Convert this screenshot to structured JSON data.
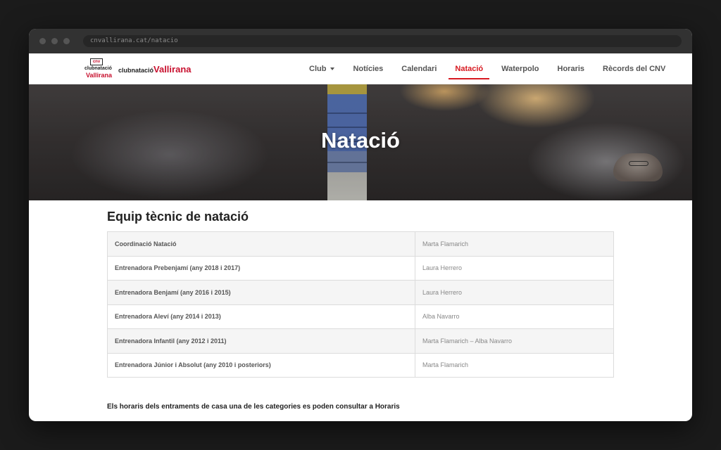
{
  "browser": {
    "url": "cnvallirana.cat/natacio"
  },
  "logo": {
    "mark_top": "cnv",
    "mark_line1": "clubnatació",
    "mark_line2": "Vallirana",
    "text_prefix": "clubnatació",
    "text_name": "Vallirana"
  },
  "nav": {
    "items": [
      {
        "label": "Club",
        "has_caret": true
      },
      {
        "label": "Notícies"
      },
      {
        "label": "Calendari"
      },
      {
        "label": "Natació",
        "active": true
      },
      {
        "label": "Waterpolo"
      },
      {
        "label": "Horaris"
      },
      {
        "label": "Rècords del CNV"
      }
    ]
  },
  "hero": {
    "title": "Natació"
  },
  "main": {
    "section_title": "Equip tècnic de natació",
    "table": [
      {
        "role": "Coordinació Natació",
        "name": "Marta Flamarich"
      },
      {
        "role": "Entrenadora Prebenjamí (any 2018 i 2017)",
        "name": "Laura Herrero"
      },
      {
        "role": "Entrenadora Benjamí (any 2016 i 2015)",
        "name": "Laura Herrero"
      },
      {
        "role": "Entrenadora Aleví (any 2014 i 2013)",
        "name": "Alba Navarro"
      },
      {
        "role": "Entrenadora Infantil (any 2012 i 2011)",
        "name": "Marta Flamarich – Alba Navarro"
      },
      {
        "role": "Entrenadora Júnior i Absolut (any 2010 i posteriors)",
        "name": "Marta Flamarich"
      }
    ],
    "footnote": "Els horaris dels entraments de casa una de les categories es poden consultar a Horaris"
  },
  "colors": {
    "accent": "#d71920",
    "brand_red": "#c8102e"
  }
}
